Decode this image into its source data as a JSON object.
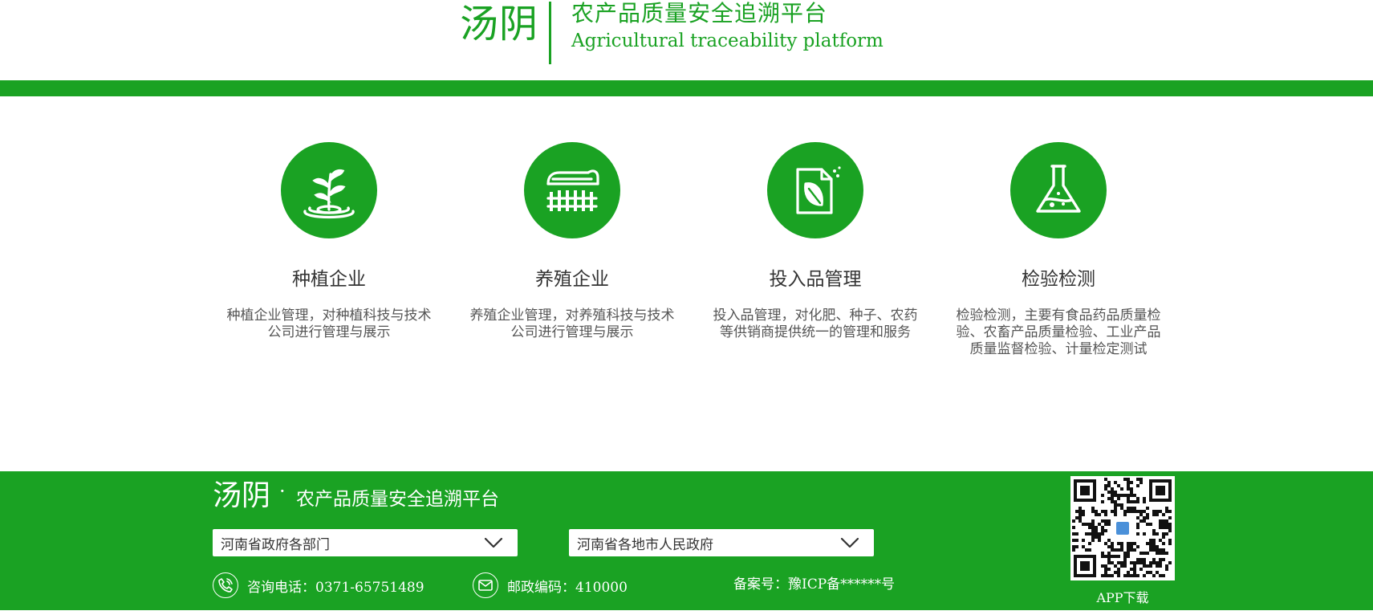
{
  "header": {
    "brand_name": "汤阴",
    "title_cn": "农产品质量安全追溯平台",
    "title_en": "Agricultural traceability platform"
  },
  "colors": {
    "brand_green": "#1aa223",
    "text": "#333333"
  },
  "features": [
    {
      "icon": "sprout-icon",
      "title": "种植企业",
      "desc": "种植企业管理，对种植科技与技术公司进行管理与展示"
    },
    {
      "icon": "barn-icon",
      "title": "养殖企业",
      "desc": "养殖企业管理，对养殖科技与技术公司进行管理与展示"
    },
    {
      "icon": "leaf-document-icon",
      "title": "投入品管理",
      "desc": "投入品管理，对化肥、种子、农药等供销商提供统一的管理和服务"
    },
    {
      "icon": "flask-icon",
      "title": "检验检测",
      "desc": "检验检测，主要有食品药品质量检验、农畜产品质量检验、工业产品质量监督检验、计量检定测试"
    }
  ],
  "footer": {
    "brand_name": "汤阴",
    "dot": "·",
    "brand_title": "农产品质量安全追溯平台",
    "select_departments": "河南省政府各部门",
    "select_cities": "河南省各地市人民政府",
    "phone": "咨询电话：0371-65751489",
    "postcode": "邮政编码：410000",
    "icp": "备案号：豫ICP备******号",
    "qr_label": "APP下载"
  }
}
